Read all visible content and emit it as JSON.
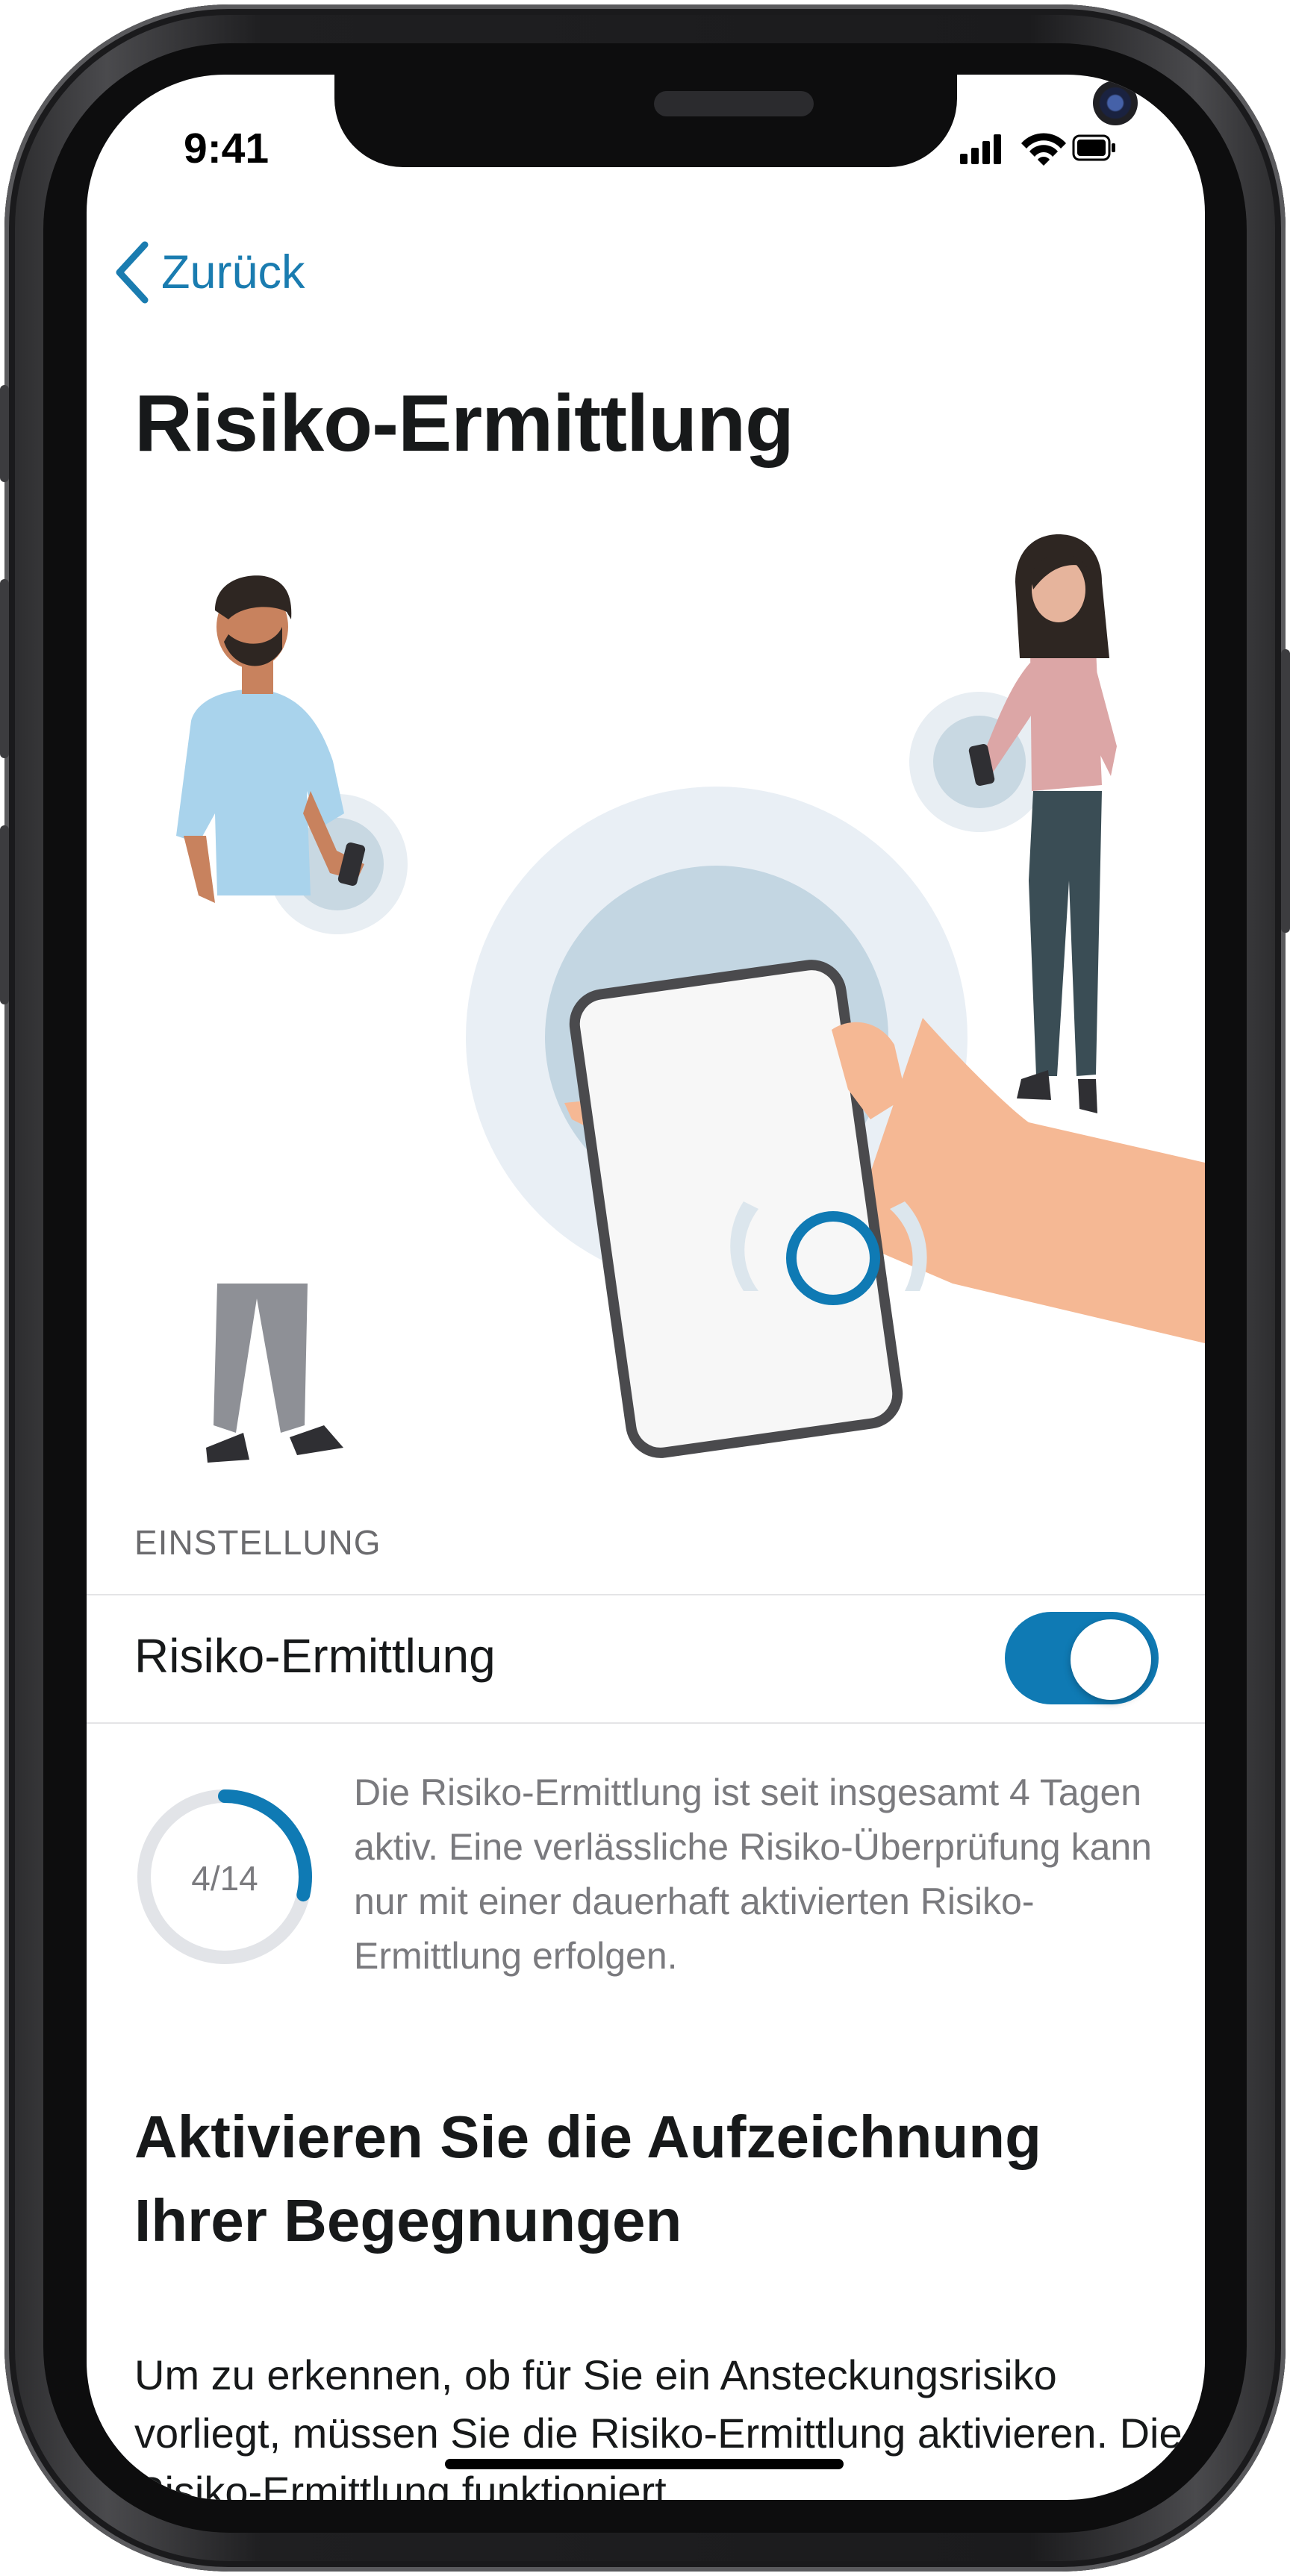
{
  "status_bar": {
    "time": "9:41"
  },
  "navigation": {
    "back_label": "Zurück"
  },
  "page": {
    "title": "Risiko-Ermittlung"
  },
  "settings": {
    "section_header": "EINSTELLUNG",
    "toggle_label": "Risiko-Ermittlung",
    "toggle_on": true
  },
  "progress": {
    "label": "4/14",
    "fraction": 0.2857,
    "description": "Die Risiko-Ermittlung ist seit insgesamt 4 Tagen aktiv. Eine verlässliche Risiko-Überprüfung kann nur mit einer dauerhaft aktivierten Risiko-Ermittlung erfolgen."
  },
  "info": {
    "title": "Aktivieren Sie die Aufzeichnung Ihrer Begegnungen",
    "body": "Um zu erkennen, ob für Sie ein Ansteckungsrisiko vorliegt, müssen Sie die Risiko-Ermittlung aktivieren. Die Risiko-Ermittlung funktioniert,"
  },
  "colors": {
    "accent": "#0f7ab4",
    "link": "#1a7cb0",
    "text": "#17191a",
    "secondary_text": "#7a7a7e",
    "ring_track": "#e2e4e8"
  },
  "icons": {
    "back": "chevron-left-icon",
    "signal": "cellular-signal-icon",
    "wifi": "wifi-icon",
    "battery": "battery-icon"
  }
}
